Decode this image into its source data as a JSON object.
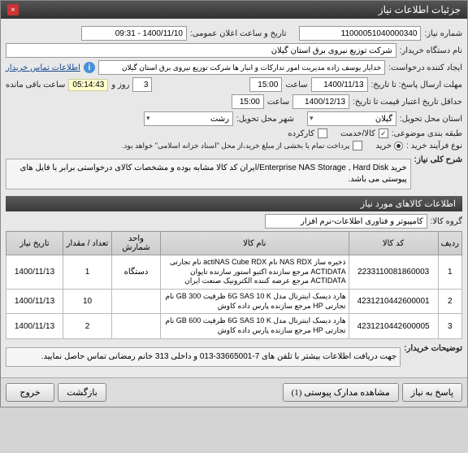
{
  "window": {
    "title": "جزئیات اطلاعات نیاز"
  },
  "header": {
    "need_no_label": "شماره نیاز:",
    "need_no": "11000051040000340",
    "announce_label": "تاریخ و ساعت اعلان عمومی:",
    "announce_value": "1400/11/10 - 09:31",
    "buyer_label": "نام دستگاه خریدار:",
    "buyer": "شرکت توزیع نیروی برق استان گیلان",
    "requester_label": "ایجاد کننده درخواست:",
    "requester": "خدایار یوسف زاده مدیریت امور تدارکات و انبار ها شرکت توزیع نیروی برق استان گیلان",
    "contact_link": "اطلاعات تماس خریدار",
    "deadline_label": "مهلت ارسال پاسخ: تا تاریخ:",
    "deadline_date": "1400/11/13",
    "time_label": "ساعت",
    "deadline_time": "15:00",
    "day_label": "روز و",
    "days_left": "3",
    "time_left": "05:14:43",
    "time_left_label": "ساعت باقی مانده",
    "credit_label": "حداقل تاریخ اعتبار قیمت تا تاریخ:",
    "credit_date": "1400/12/13",
    "credit_time": "15:00",
    "province_label": "استان محل تحویل:",
    "province": "گیلان",
    "city_label": "شهر محل تحویل:",
    "city": "رشت",
    "category_label": "طبقه بندی موضوعی:",
    "cat_goods": "كالا/خدمت",
    "cat_used": "کارکرده",
    "process_label": "نوع فرآیند خرید :",
    "process_option": "خرید",
    "payment_note": "پرداخت تمام یا بخشی از مبلغ خرید،از محل \"اسناد خزانه اسلامی\" خواهد بود."
  },
  "desc": {
    "title": "شرح کلی نیاز:",
    "text": "خرید Enterprise NAS Storage , Hard Disk/ایران کد کالا مشابه بوده و مشخصات کالای درخواستی برابر با فایل های پیوستی می باشد."
  },
  "goods_section": "اطلاعات کالاهای مورد نیاز",
  "group_label": "گروه کالا:",
  "group_value": "کامپیوتر و فناوری اطلاعات-نرم افزار",
  "table": {
    "headers": [
      "ردیف",
      "کد کالا",
      "نام کالا",
      "واحد شمارش",
      "تعداد / مقدار",
      "تاریخ نیاز"
    ],
    "rows": [
      {
        "idx": "1",
        "code": "2233110081860003",
        "name": "ذخیره ساز NAS RDX نام actiNAS Cube RDX نام تجارتی ACTIDATA مرجع سازنده اکتیو استور سازنده تایوان ACTIDATA مرجع عرضه کننده الکترونیک صنعت ایران",
        "unit": "دستگاه",
        "qty": "1",
        "date": "1400/11/13"
      },
      {
        "idx": "2",
        "code": "4231210442600001",
        "name": "هارد دیسک اینترنال مدل 6G SAS 10 K ظرفیت GB 300 نام تجارتی HP مرجع سازنده پارس داده کاوش",
        "unit": "",
        "qty": "10",
        "date": "1400/11/13"
      },
      {
        "idx": "3",
        "code": "4231210442600005",
        "name": "هارد دیسک اینترنال مدل 6G SAS 10 K ظرفیت GB 600 نام تجارتی HP مرجع سازنده پارس داده کاوش",
        "unit": "",
        "qty": "2",
        "date": "1400/11/13"
      }
    ]
  },
  "buyer_note": {
    "label": "توضیحات خریدار:",
    "text": "جهت دریافت اطلاعات بیشتر با تلفن های 7-33665001-013 و داخلی 313 خانم رمضانی تماس حاصل نمایید."
  },
  "buttons": {
    "reply": "پاسخ به نیاز",
    "attachments": "مشاهده مدارک پیوستی (1)",
    "back": "بازگشت",
    "exit": "خروج"
  }
}
